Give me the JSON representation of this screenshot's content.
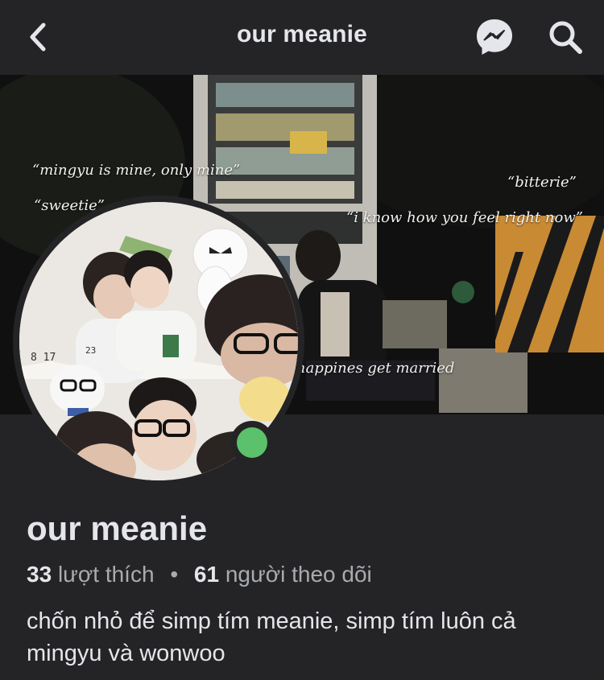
{
  "header": {
    "title": "our meanie",
    "back_icon": "chevron-left-icon",
    "messenger_icon": "messenger-icon",
    "search_icon": "search-icon"
  },
  "cover": {
    "quotes": [
      "“mingyu is mine, only mine”",
      "“sweetie”",
      "“bitterie”",
      "“i know how you feel right now”",
      "happines get married"
    ]
  },
  "avatar": {
    "badge": "8 17",
    "number": "23",
    "online": true
  },
  "profile": {
    "name": "our meanie",
    "likes_count": "33",
    "likes_label": "lượt thích",
    "separator": "•",
    "followers_count": "61",
    "followers_label": "người theo dõi",
    "bio": "chốn nhỏ để simp tím meanie, simp tím luôn cả mingyu và wonwoo"
  },
  "colors": {
    "background": "#242426",
    "online": "#5bc16b",
    "text_primary": "#e4e6eb",
    "text_secondary": "#a8abaf"
  }
}
